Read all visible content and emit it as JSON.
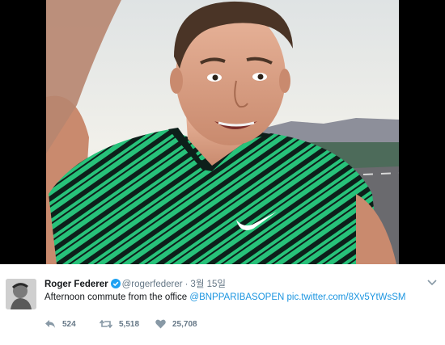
{
  "media": {
    "description_icon": "photo",
    "shirt_logo": "nike-swoosh-icon"
  },
  "tweet": {
    "name": "Roger Federer",
    "handle": "@rogerfederer",
    "separator": "·",
    "date": "3월 15일",
    "text_prefix": "Afternoon commute from the office ",
    "mention": "@BNPPARIBASOPEN",
    "link": "pic.twitter.com/8Xv5YtWsSM",
    "replies": "524",
    "retweets": "5,518",
    "likes": "25,708"
  },
  "colors": {
    "link": "#1b95e0",
    "secondary": "#657786",
    "verified": "#1da1f2"
  }
}
